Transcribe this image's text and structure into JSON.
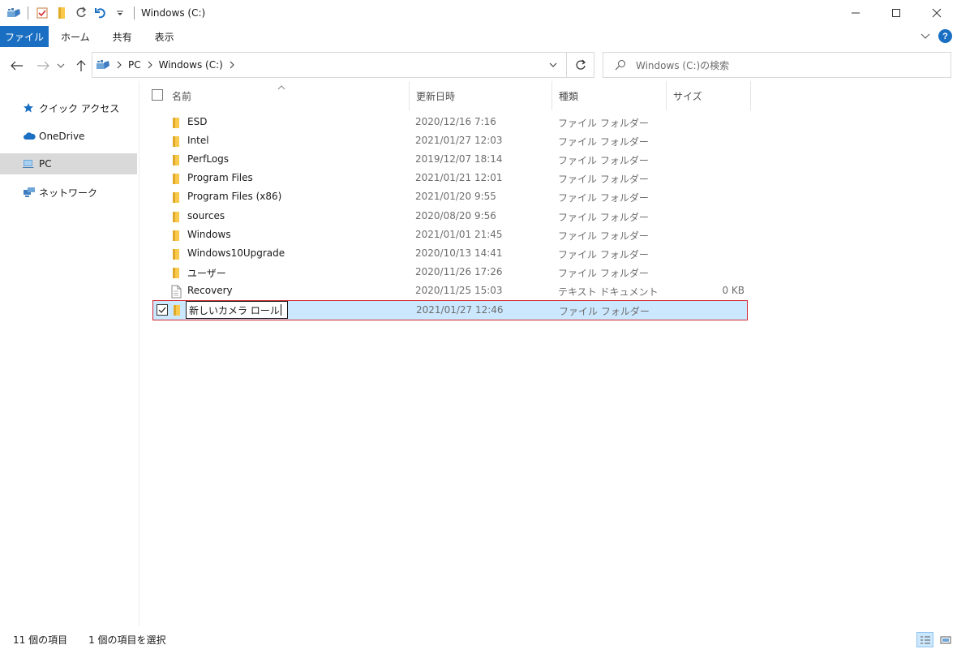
{
  "window": {
    "title": "Windows (C:)"
  },
  "ribbon": {
    "tabs": [
      "ファイル",
      "ホーム",
      "共有",
      "表示"
    ]
  },
  "address": {
    "crumbs": [
      "PC",
      "Windows (C:)"
    ]
  },
  "search": {
    "placeholder": "Windows (C:)の検索"
  },
  "sidebar": {
    "items": [
      {
        "label": "クイック アクセス",
        "icon": "star-icon"
      },
      {
        "label": "OneDrive",
        "icon": "cloud-icon"
      },
      {
        "label": "PC",
        "icon": "pc-icon",
        "selected": true
      },
      {
        "label": "ネットワーク",
        "icon": "network-icon"
      }
    ]
  },
  "columns": {
    "name": "名前",
    "date": "更新日時",
    "type": "種類",
    "size": "サイズ"
  },
  "files": [
    {
      "name": "ESD",
      "date": "2020/12/16 7:16",
      "type": "ファイル フォルダー",
      "size": "",
      "icon": "folder-icon"
    },
    {
      "name": "Intel",
      "date": "2021/01/27 12:03",
      "type": "ファイル フォルダー",
      "size": "",
      "icon": "folder-icon"
    },
    {
      "name": "PerfLogs",
      "date": "2019/12/07 18:14",
      "type": "ファイル フォルダー",
      "size": "",
      "icon": "folder-icon"
    },
    {
      "name": "Program Files",
      "date": "2021/01/21 12:01",
      "type": "ファイル フォルダー",
      "size": "",
      "icon": "folder-icon"
    },
    {
      "name": "Program Files (x86)",
      "date": "2021/01/20 9:55",
      "type": "ファイル フォルダー",
      "size": "",
      "icon": "folder-icon"
    },
    {
      "name": "sources",
      "date": "2020/08/20 9:56",
      "type": "ファイル フォルダー",
      "size": "",
      "icon": "folder-icon"
    },
    {
      "name": "Windows",
      "date": "2021/01/01 21:45",
      "type": "ファイル フォルダー",
      "size": "",
      "icon": "folder-icon"
    },
    {
      "name": "Windows10Upgrade",
      "date": "2020/10/13 14:41",
      "type": "ファイル フォルダー",
      "size": "",
      "icon": "folder-icon"
    },
    {
      "name": "ユーザー",
      "date": "2020/11/26 17:26",
      "type": "ファイル フォルダー",
      "size": "",
      "icon": "folder-icon"
    },
    {
      "name": "Recovery",
      "date": "2020/11/25 15:03",
      "type": "テキスト ドキュメント",
      "size": "0 KB",
      "icon": "text-file-icon"
    },
    {
      "name": "新しいカメラ ロール",
      "date": "2021/01/27 12:46",
      "type": "ファイル フォルダー",
      "size": "",
      "icon": "folder-icon",
      "selected": true,
      "renaming": true
    }
  ],
  "status": {
    "count": "11 個の項目",
    "selected": "1 個の項目を選択"
  },
  "colors": {
    "accent": "#1a6fc2",
    "selection": "#cce8ff",
    "highlight_border": "#d4272f",
    "folder": "#f8c94a"
  }
}
